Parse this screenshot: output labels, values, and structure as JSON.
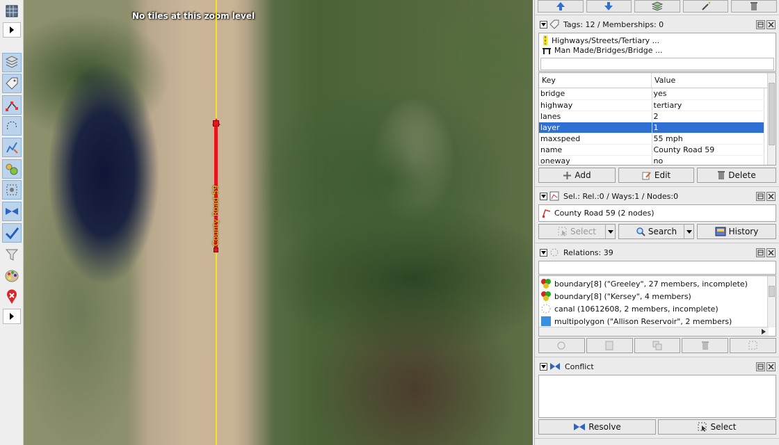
{
  "map": {
    "no_tiles_text": "No tiles at this zoom level",
    "road_label": "County Road 59"
  },
  "toolbar": {
    "tools": [
      "wireframe-icon",
      "layers-icon",
      "tag-icon",
      "select-node-icon",
      "lasso-icon",
      "edit-icon",
      "nodes-icon",
      "selection-icon",
      "conflict-icon",
      "check-icon",
      "filter-icon",
      "palette-icon",
      "delete-marker-icon"
    ]
  },
  "tags": {
    "title": "Tags: 12 / Memberships: 0",
    "presets": [
      "Highways/Streets/Tertiary ...",
      "Man Made/Bridges/Bridge ..."
    ],
    "col_key": "Key",
    "col_value": "Value",
    "rows": [
      {
        "key": "bridge",
        "value": "yes"
      },
      {
        "key": "highway",
        "value": "tertiary"
      },
      {
        "key": "lanes",
        "value": "2"
      },
      {
        "key": "layer",
        "value": "1"
      },
      {
        "key": "maxspeed",
        "value": "55 mph"
      },
      {
        "key": "name",
        "value": "County Road 59"
      },
      {
        "key": "oneway",
        "value": "no"
      }
    ],
    "add_label": "Add",
    "edit_label": "Edit",
    "delete_label": "Delete"
  },
  "selection": {
    "title": "Sel.: Rel.:0 / Ways:1 / Nodes:0",
    "item": "County Road 59 (2 nodes)",
    "select_label": "Select",
    "search_label": "Search",
    "history_label": "History"
  },
  "relations": {
    "title": "Relations: 39",
    "items": [
      "boundary[8] (\"Greeley\", 27 members, incomplete)",
      "boundary[8] (\"Kersey\", 4 members)",
      "canal (10612608, 2 members, incomplete)",
      "multipolygon (\"Allison Reservoir\", 2 members)"
    ]
  },
  "conflict": {
    "title": "Conflict",
    "resolve_label": "Resolve",
    "select_label": "Select"
  },
  "colors": {
    "selection_blue": "#2F6FD3",
    "road_yellow": "#F5E31C",
    "selected_way_red": "#E8141B"
  }
}
